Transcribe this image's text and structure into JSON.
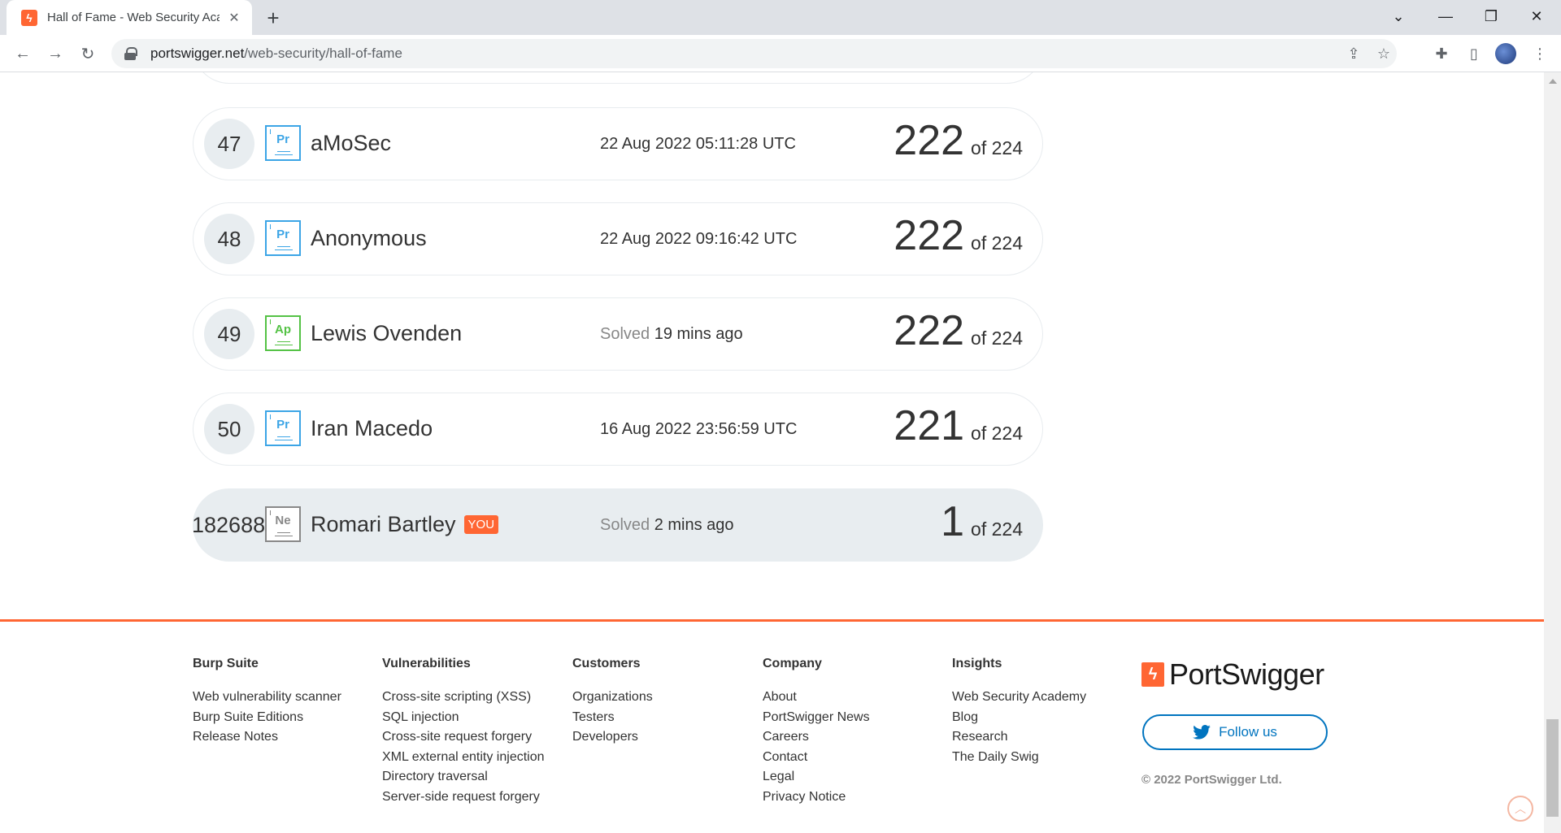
{
  "browser": {
    "tab_title": "Hall of Fame - Web Security Academy",
    "url_domain": "portswigger.net",
    "url_path": "/web-security/hall-of-fame"
  },
  "leaderboard": {
    "rows": [
      {
        "rank": "47",
        "badge": "Pr",
        "name": "aMoSec",
        "date_prefix": "",
        "date": "22 Aug 2022 05:11:28 UTC",
        "score": "222",
        "of_label": "of 224"
      },
      {
        "rank": "48",
        "badge": "Pr",
        "name": "Anonymous",
        "date_prefix": "",
        "date": "22 Aug 2022 09:16:42 UTC",
        "score": "222",
        "of_label": "of 224"
      },
      {
        "rank": "49",
        "badge": "Ap",
        "name": "Lewis Ovenden",
        "date_prefix": "Solved",
        "date": "19 mins ago",
        "score": "222",
        "of_label": "of 224"
      },
      {
        "rank": "50",
        "badge": "Pr",
        "name": "Iran Macedo",
        "date_prefix": "",
        "date": "16 Aug 2022 23:56:59 UTC",
        "score": "221",
        "of_label": "of 224"
      }
    ],
    "you_row": {
      "rank": "182688",
      "badge": "Ne",
      "name": "Romari Bartley",
      "you_label": "YOU",
      "date_prefix": "Solved",
      "date": "2 mins ago",
      "score": "1",
      "of_label": "of 224"
    }
  },
  "footer": {
    "columns": [
      {
        "heading": "Burp Suite",
        "links": [
          "Web vulnerability scanner",
          "Burp Suite Editions",
          "Release Notes"
        ]
      },
      {
        "heading": "Vulnerabilities",
        "links": [
          "Cross-site scripting (XSS)",
          "SQL injection",
          "Cross-site request forgery",
          "XML external entity injection",
          "Directory traversal",
          "Server-side request forgery"
        ]
      },
      {
        "heading": "Customers",
        "links": [
          "Organizations",
          "Testers",
          "Developers"
        ]
      },
      {
        "heading": "Company",
        "links": [
          "About",
          "PortSwigger News",
          "Careers",
          "Contact",
          "Legal",
          "Privacy Notice"
        ]
      },
      {
        "heading": "Insights",
        "links": [
          "Web Security Academy",
          "Blog",
          "Research",
          "The Daily Swig"
        ]
      }
    ],
    "brand": "PortSwigger",
    "follow_label": "Follow us",
    "copyright": "© 2022 PortSwigger Ltd."
  },
  "colors": {
    "accent": "#ff6633",
    "practitioner": "#3ca5e6",
    "apprentice": "#54c245",
    "twitter": "#0074bf"
  }
}
